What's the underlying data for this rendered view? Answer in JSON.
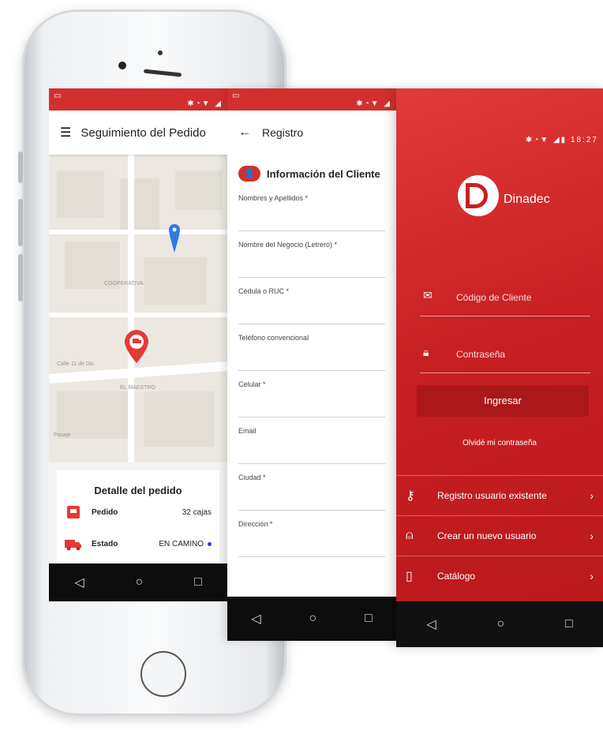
{
  "phone1": {
    "app_title": "Seguimiento del Pedido",
    "map": {
      "street_labels": [
        "Calle 11 de Dic",
        "COOPERATIVA",
        "EL MAESTRO",
        "Pasaje"
      ]
    },
    "detail": {
      "heading": "Detalle del pedido",
      "rows": [
        {
          "key": "Pedido",
          "value": "32 cajas",
          "icon": "box-icon"
        },
        {
          "key": "Estado",
          "value": "EN CAMINO",
          "icon": "truck-icon"
        }
      ]
    }
  },
  "phone2": {
    "app_title": "Registro",
    "section_title": "Información del Cliente",
    "fields": [
      "Nombres y Apellidos *",
      "Nombre del Negocio (Letrero) *",
      "Cédula o RUC *",
      "Teléfono convencional",
      "Celular *",
      "Email",
      "Ciudad *",
      "Dirección *"
    ]
  },
  "phone3": {
    "status_time": "18:27",
    "brand": "Dinadec",
    "fields": [
      {
        "icon": "mail-icon",
        "placeholder": "Código de Cliente"
      },
      {
        "icon": "lock-icon",
        "placeholder": "Contraseña"
      }
    ],
    "login_button": "Ingresar",
    "forgot_link": "Olvidé mi contraseña",
    "menu": [
      {
        "icon": "user-key-icon",
        "label": "Registro usuario existente"
      },
      {
        "icon": "user-icon",
        "label": "Crear un nuevo usuario"
      },
      {
        "icon": "book-icon",
        "label": "Catálogo"
      }
    ]
  },
  "colors": {
    "brand_red": "#d32f2f",
    "dark_red": "#b8181b",
    "map_bg": "#ece8e1"
  }
}
